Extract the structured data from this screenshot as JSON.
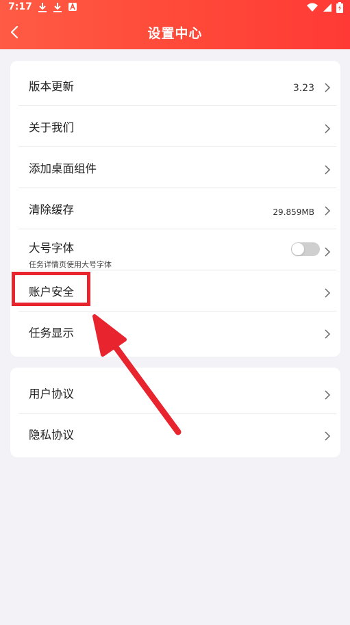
{
  "status_bar": {
    "time": "7:17",
    "left_icons": [
      "download-icon",
      "download-icon",
      "a-icon"
    ],
    "right_icons": [
      "wifi-icon",
      "signal-icon",
      "battery-charging-icon"
    ]
  },
  "header": {
    "title": "设置中心",
    "back_icon": "back-arrow-icon",
    "gradient_colors": [
      "#ff5b45",
      "#ff3a36"
    ]
  },
  "settings_group_1": [
    {
      "label": "版本更新",
      "value": "3.23"
    },
    {
      "label": "关于我们"
    },
    {
      "label": "添加桌面组件"
    },
    {
      "label": "清除缓存",
      "value": "29.859MB"
    },
    {
      "label": "大号字体",
      "subtitle": "任务详情页使用大号字体",
      "toggle": false
    },
    {
      "label": "账户安全"
    },
    {
      "label": "任务显示"
    }
  ],
  "settings_group_2": [
    {
      "label": "用户协议"
    },
    {
      "label": "隐私协议"
    }
  ],
  "annotation": {
    "color": "#e8242f",
    "target": "账户安全",
    "shapes": [
      "highlight-box",
      "arrow"
    ]
  }
}
